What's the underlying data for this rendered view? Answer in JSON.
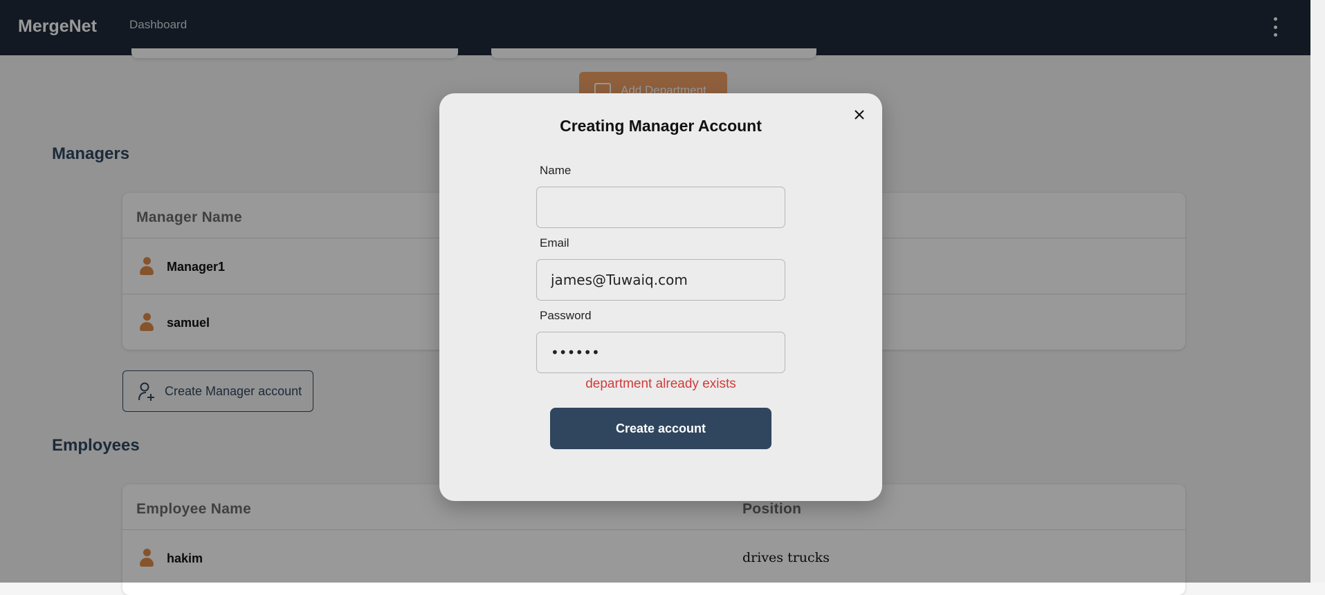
{
  "navbar": {
    "brand": "MergeNet",
    "links": [
      "Dashboard"
    ],
    "menu_icon": "kebab-menu-icon"
  },
  "departments": {
    "add_button_label": "Add Department"
  },
  "managers": {
    "section_title": "Managers",
    "columns": [
      "Manager Name"
    ],
    "rows": [
      {
        "name": "Manager1"
      },
      {
        "name": "samuel"
      }
    ],
    "create_button_label": "Create Manager account"
  },
  "employees": {
    "section_title": "Employees",
    "columns": [
      "Employee Name",
      "Position"
    ],
    "rows": [
      {
        "name": "hakim",
        "position": "drives trucks"
      }
    ]
  },
  "modal": {
    "title": "Creating Manager Account",
    "close_icon": "close-icon",
    "fields": {
      "name": {
        "label": "Name",
        "value": ""
      },
      "email": {
        "label": "Email",
        "value": "james@Tuwaiq.com"
      },
      "password": {
        "label": "Password",
        "value": "123456"
      }
    },
    "error": "department already exists",
    "submit_label": "Create account"
  },
  "colors": {
    "navbar": "#1e2b3a",
    "accent": "#2f465e",
    "orange": "#f1a067",
    "error": "#d23a3a",
    "icon": "#e08c4a"
  }
}
